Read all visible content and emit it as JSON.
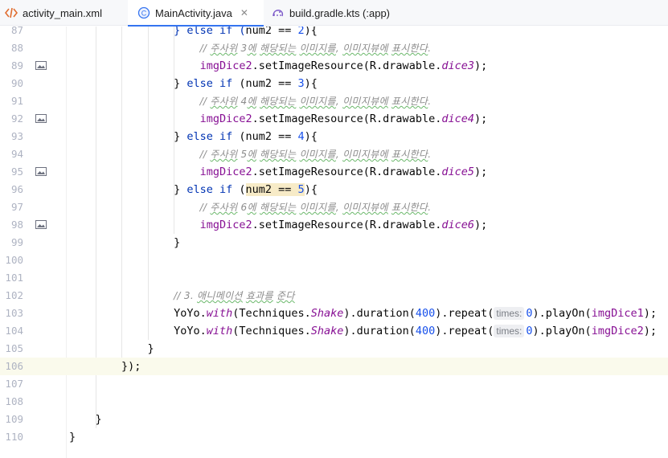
{
  "tabs": [
    {
      "label": "activity_main.xml",
      "icon": "xml-file-icon",
      "active": false
    },
    {
      "label": "MainActivity.java",
      "icon": "java-class-icon",
      "active": true
    },
    {
      "label": "build.gradle.kts (:app)",
      "icon": "gradle-file-icon",
      "active": false
    }
  ],
  "tab_close": "✕",
  "colors": {
    "accent": "#3574f0",
    "keyword": "#0033b3",
    "number": "#1750eb",
    "field": "#871094",
    "comment": "#8c8c8c",
    "current_line": "#fafaec"
  },
  "lines": [
    {
      "n": "87",
      "indent": 16,
      "parts": [
        [
          "kw",
          "} else if ("
        ],
        [
          "pl",
          "num2 == "
        ],
        [
          "num",
          "2"
        ],
        [
          "pl",
          ")"
        ],
        [
          "pl",
          "{"
        ]
      ],
      "icon": false
    },
    {
      "n": "88",
      "indent": 20,
      "parts": [
        [
          "cmt",
          "// 주사위 3에 해당되는 이미지를, 이미지뷰에 표시한다."
        ]
      ],
      "icon": false
    },
    {
      "n": "89",
      "indent": 20,
      "parts": [
        [
          "fld",
          "imgDice2"
        ],
        [
          "pl",
          ".setImageResource(R.drawable."
        ],
        [
          "it",
          "dice3"
        ],
        [
          "pl",
          ");"
        ]
      ],
      "icon": true
    },
    {
      "n": "90",
      "indent": 16,
      "parts": [
        [
          "pl",
          "} "
        ],
        [
          "kw",
          "else if"
        ],
        [
          "pl",
          " (num2 == "
        ],
        [
          "num",
          "3"
        ],
        [
          "pl",
          "){"
        ]
      ],
      "icon": false
    },
    {
      "n": "91",
      "indent": 20,
      "parts": [
        [
          "cmt",
          "// 주사위 4에 해당되는 이미지를, 이미지뷰에 표시한다."
        ]
      ],
      "icon": false
    },
    {
      "n": "92",
      "indent": 20,
      "parts": [
        [
          "fld",
          "imgDice2"
        ],
        [
          "pl",
          ".setImageResource(R.drawable."
        ],
        [
          "it",
          "dice4"
        ],
        [
          "pl",
          ");"
        ]
      ],
      "icon": true
    },
    {
      "n": "93",
      "indent": 16,
      "parts": [
        [
          "pl",
          "} "
        ],
        [
          "kw",
          "else if"
        ],
        [
          "pl",
          " (num2 == "
        ],
        [
          "num",
          "4"
        ],
        [
          "pl",
          "){"
        ]
      ],
      "icon": false
    },
    {
      "n": "94",
      "indent": 20,
      "parts": [
        [
          "cmt",
          "// 주사위 5에 해당되는 이미지를, 이미지뷰에 표시한다."
        ]
      ],
      "icon": false
    },
    {
      "n": "95",
      "indent": 20,
      "parts": [
        [
          "fld",
          "imgDice2"
        ],
        [
          "pl",
          ".setImageResource(R.drawable."
        ],
        [
          "it",
          "dice5"
        ],
        [
          "pl",
          ");"
        ]
      ],
      "icon": true
    },
    {
      "n": "96",
      "indent": 16,
      "parts": [
        [
          "pl",
          "} "
        ],
        [
          "kw",
          "else if"
        ],
        [
          "pl",
          " ("
        ],
        [
          "hl",
          "num2 == "
        ],
        [
          "hlnum",
          "5"
        ],
        [
          "pl",
          "){"
        ]
      ],
      "icon": false
    },
    {
      "n": "97",
      "indent": 20,
      "parts": [
        [
          "cmt",
          "// 주사위 6에 해당되는 이미지를, 이미지뷰에 표시한다."
        ]
      ],
      "icon": false
    },
    {
      "n": "98",
      "indent": 20,
      "parts": [
        [
          "fld",
          "imgDice2"
        ],
        [
          "pl",
          ".setImageResource(R.drawable."
        ],
        [
          "it",
          "dice6"
        ],
        [
          "pl",
          ");"
        ]
      ],
      "icon": true
    },
    {
      "n": "99",
      "indent": 16,
      "parts": [
        [
          "pl",
          "}"
        ]
      ],
      "icon": false
    },
    {
      "n": "100",
      "indent": 0,
      "parts": [],
      "icon": false
    },
    {
      "n": "101",
      "indent": 0,
      "parts": [],
      "icon": false
    },
    {
      "n": "102",
      "indent": 16,
      "parts": [
        [
          "cmt",
          "// 3. 애니메이션 효과를 준다"
        ]
      ],
      "icon": false
    },
    {
      "n": "103",
      "indent": 16,
      "parts": [
        [
          "pl",
          "YoYo."
        ],
        [
          "it",
          "with"
        ],
        [
          "pl",
          "(Techniques."
        ],
        [
          "it",
          "Shake"
        ],
        [
          "pl",
          ").duration("
        ],
        [
          "num",
          "400"
        ],
        [
          "pl",
          ").repeat("
        ],
        [
          "hint",
          "times:"
        ],
        [
          "num",
          "0"
        ],
        [
          "pl",
          ").playOn("
        ],
        [
          "fld",
          "imgDice1"
        ],
        [
          "pl",
          ");"
        ]
      ],
      "icon": false
    },
    {
      "n": "104",
      "indent": 16,
      "parts": [
        [
          "pl",
          "YoYo."
        ],
        [
          "it",
          "with"
        ],
        [
          "pl",
          "(Techniques."
        ],
        [
          "it",
          "Shake"
        ],
        [
          "pl",
          ").duration("
        ],
        [
          "num",
          "400"
        ],
        [
          "pl",
          ").repeat("
        ],
        [
          "hint",
          "times:"
        ],
        [
          "num",
          "0"
        ],
        [
          "pl",
          ").playOn("
        ],
        [
          "fld",
          "imgDice2"
        ],
        [
          "pl",
          ");"
        ]
      ],
      "icon": false
    },
    {
      "n": "105",
      "indent": 12,
      "parts": [
        [
          "pl",
          "}"
        ]
      ],
      "icon": false
    },
    {
      "n": "106",
      "indent": 8,
      "parts": [
        [
          "pl",
          "});"
        ]
      ],
      "icon": false,
      "current": true
    },
    {
      "n": "107",
      "indent": 0,
      "parts": [],
      "icon": false
    },
    {
      "n": "108",
      "indent": 0,
      "parts": [],
      "icon": false
    },
    {
      "n": "109",
      "indent": 4,
      "parts": [
        [
          "pl",
          "}"
        ]
      ],
      "icon": false
    },
    {
      "n": "110",
      "indent": 0,
      "parts": [
        [
          "pl",
          "}"
        ]
      ],
      "icon": false
    }
  ]
}
